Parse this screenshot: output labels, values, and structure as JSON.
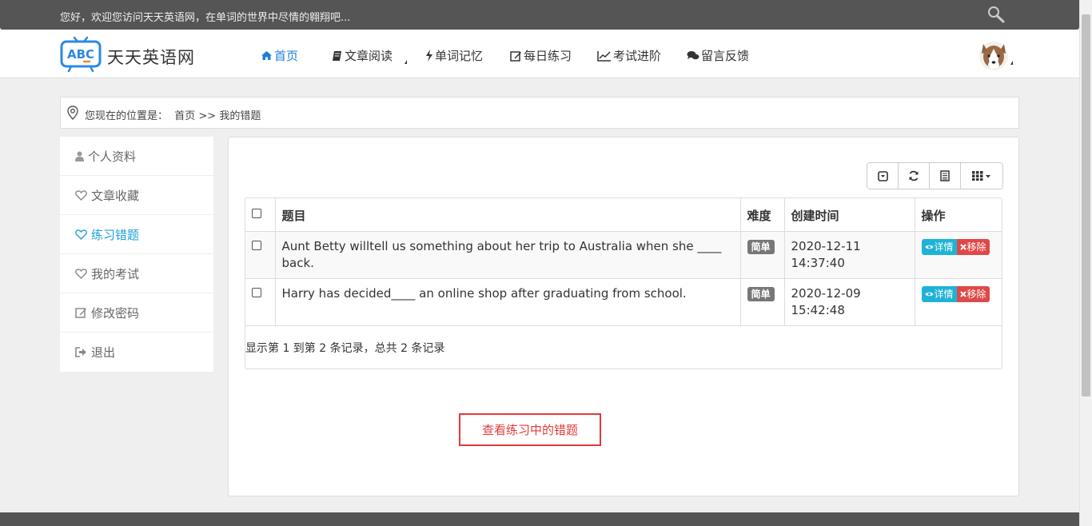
{
  "topbar": {
    "welcome": "您好，欢迎您访问天天英语网，在单词的世界中尽情的翱翔吧..."
  },
  "header": {
    "site_name": "天天英语网",
    "nav": [
      {
        "label": "首页",
        "active": true
      },
      {
        "label": "文章阅读"
      },
      {
        "label": "单词记忆"
      },
      {
        "label": "每日练习"
      },
      {
        "label": "考试进阶"
      },
      {
        "label": "留言反馈"
      }
    ]
  },
  "breadcrumb": {
    "text": "您现在的位置是：  首页 >> 我的错题"
  },
  "sidebar": {
    "items": [
      {
        "label": "个人资料",
        "icon": "user-icon"
      },
      {
        "label": "文章收藏",
        "icon": "heart-icon"
      },
      {
        "label": "练习错题",
        "icon": "heart-icon",
        "active": true
      },
      {
        "label": "我的考试",
        "icon": "heart-icon"
      },
      {
        "label": "修改密码",
        "icon": "edit-icon"
      },
      {
        "label": "退出",
        "icon": "logout-icon"
      }
    ]
  },
  "table": {
    "headers": [
      "题目",
      "难度",
      "创建时间",
      "操作"
    ],
    "rows": [
      {
        "question": "Aunt Betty willtell us something about her trip to Australia when she ____ back.",
        "difficulty": "简单",
        "created": "2020-12-11 14:37:40",
        "detail": "详情",
        "remove": "移除"
      },
      {
        "question": "Harry has decided____ an online shop after graduating from school.",
        "difficulty": "简单",
        "created": "2020-12-09 15:42:48",
        "detail": "详情",
        "remove": "移除"
      }
    ],
    "summary": "显示第 1 到第 2 条记录，总共 2 条记录"
  },
  "annotation": "查看练习中的错题",
  "colors": {
    "accent": "#1e7fd8",
    "sidebar_active": "#1ea0d6",
    "detail_btn": "#1eb3d6",
    "remove_btn": "#e04848",
    "annotation": "#e03a3a"
  }
}
